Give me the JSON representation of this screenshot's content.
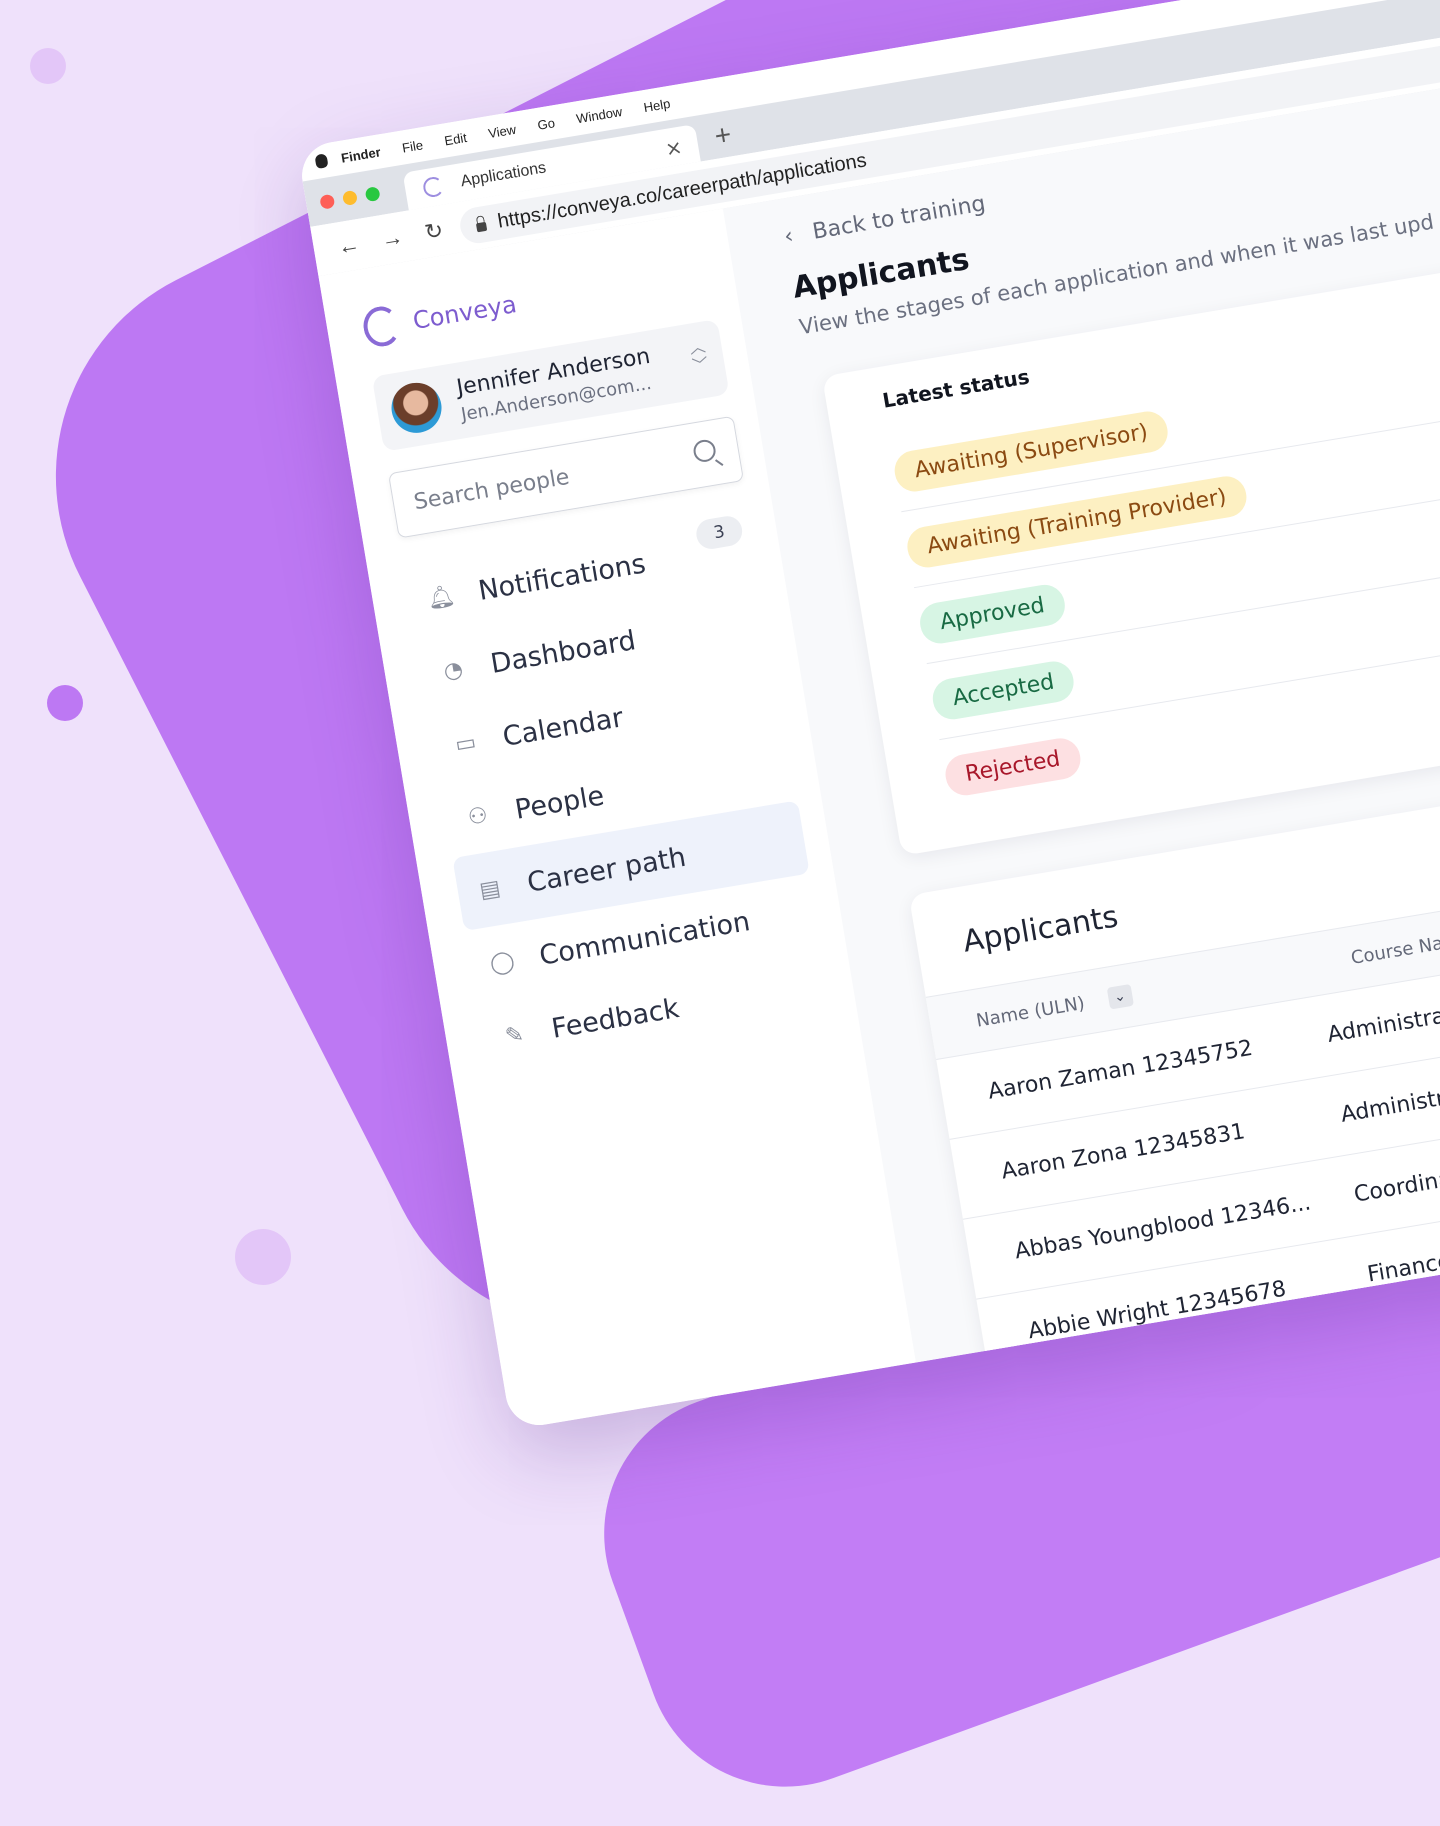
{
  "os_menu": {
    "items": [
      "Finder",
      "File",
      "Edit",
      "View",
      "Go",
      "Window",
      "Help"
    ]
  },
  "browser": {
    "tab_title": "Applications",
    "url": "https://conveya.co/careerpath/applications",
    "colors": {
      "close": "#fe5f57",
      "minimize": "#febc2e",
      "zoom": "#28c840"
    }
  },
  "sidebar": {
    "brand": "Conveya",
    "user": {
      "name": "Jennifer Anderson",
      "email": "Jen.Anderson@com..."
    },
    "search_placeholder": "Search people",
    "notifications_count": "3",
    "items": [
      {
        "label": "Notifications",
        "icon": "bell-icon"
      },
      {
        "label": "Dashboard",
        "icon": "pie-chart-icon"
      },
      {
        "label": "Calendar",
        "icon": "calendar-icon"
      },
      {
        "label": "People",
        "icon": "people-icon"
      },
      {
        "label": "Career path",
        "icon": "briefcase-icon",
        "active": true
      },
      {
        "label": "Communication",
        "icon": "chat-bubble-icon"
      },
      {
        "label": "Feedback",
        "icon": "feedback-icon"
      }
    ]
  },
  "main": {
    "back_label": "Back to training",
    "title": "Applicants",
    "subtitle": "View the stages of each application and when it was last upd",
    "status_card": {
      "title": "Latest status",
      "statuses": [
        {
          "label": "Awaiting (Supervisor)",
          "tone": "warn"
        },
        {
          "label": "Awaiting (Training Provider)",
          "tone": "warn"
        },
        {
          "label": "Approved",
          "tone": "ok"
        },
        {
          "label": "Accepted",
          "tone": "ok"
        },
        {
          "label": "Rejected",
          "tone": "bad"
        }
      ]
    },
    "applicants_card": {
      "title": "Applicants",
      "columns": {
        "name": "Name (ULN)",
        "course": "Course Name"
      },
      "rows": [
        {
          "name": "Aaron Zaman 12345752",
          "course": "Administrati"
        },
        {
          "name": "Aaron Zona 12345831",
          "course": "Administra"
        },
        {
          "name": "Abbas Youngblood 12346...",
          "course": "Coordinat"
        },
        {
          "name": "Abbie Wright 12345678",
          "course": "Finance"
        }
      ]
    }
  }
}
